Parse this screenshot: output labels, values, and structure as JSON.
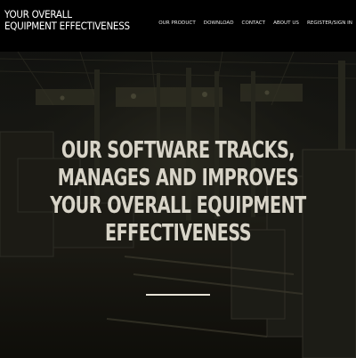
{
  "header": {
    "logo_line1": "YOUR OVERALL",
    "logo_line2": "EQUIPMENT EFFECTIVENESS",
    "nav": [
      {
        "label": "OUR PRODUCT"
      },
      {
        "label": "DOWNLOAD"
      },
      {
        "label": "CONTACT"
      },
      {
        "label": "ABOUT US"
      },
      {
        "label": "REGISTER/SIGN IN"
      }
    ]
  },
  "hero": {
    "headline_lines": [
      "OUR SOFTWARE TRACKS,",
      "MANAGES AND IMPROVES",
      "YOUR OVERALL EQUIPMENT",
      "EFFECTIVENESS"
    ],
    "background": "factory-floor-photo"
  },
  "colors": {
    "header_bg": "#000000",
    "header_text": "#ffffff",
    "headline_text": "#d8d4c8",
    "divider": "#e6e2d6",
    "overlay": "#0b0b0a"
  }
}
